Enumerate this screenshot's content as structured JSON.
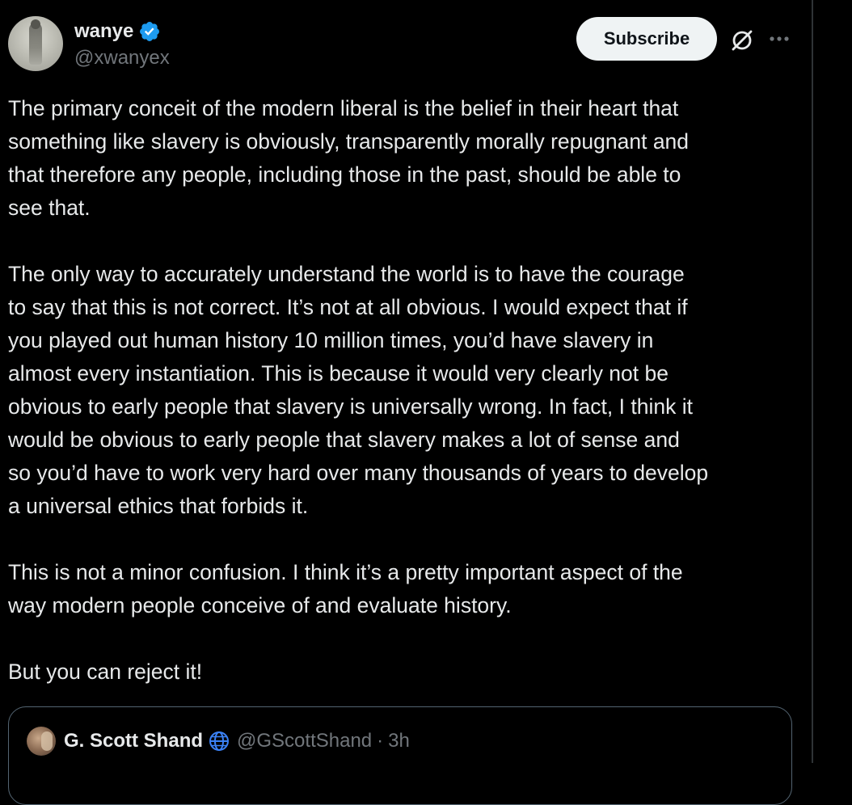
{
  "author": {
    "display_name": "wanye",
    "handle": "@xwanyex",
    "verified": true
  },
  "actions": {
    "subscribe_label": "Subscribe",
    "grok_icon": "grok-icon",
    "more_icon": "more-icon"
  },
  "tweet": {
    "paragraphs": [
      {
        "lines": [
          "The primary conceit of the modern liberal is the belief in their heart that",
          "something like slavery is obviously, transparently morally repugnant and",
          "that therefore any people, including those in the past, should be able to",
          "see that."
        ]
      },
      {
        "lines": [
          "The only way to accurately understand the world is to have the courage",
          "to say that this is not correct. It’s not at all obvious. I would expect that if",
          "you played out human history 10 million times, you’d have slavery in",
          "almost every instantiation. This is because it would very clearly not be",
          "obvious to early people that slavery is universally wrong. In fact, I think it",
          "would be obvious to early people that slavery makes a lot of sense and",
          "so you’d have to work very hard over many thousands of years to develop",
          "a universal ethics that forbids it."
        ]
      },
      {
        "lines": [
          "This is not a minor confusion. I think it’s a pretty important aspect of the",
          "way modern people conceive of and evaluate history."
        ]
      },
      {
        "lines": [
          "But you can reject it!"
        ]
      }
    ]
  },
  "quote": {
    "display_name": "G. Scott Shand",
    "handle": "@GScottShand",
    "separator": "·",
    "time": "3h",
    "badge_icon": "globe-icon"
  },
  "colors": {
    "background": "#000000",
    "text": "#e7e9ea",
    "muted": "#71767b",
    "verified_blue": "#1d9bf0",
    "button_bg": "#eff3f4"
  }
}
